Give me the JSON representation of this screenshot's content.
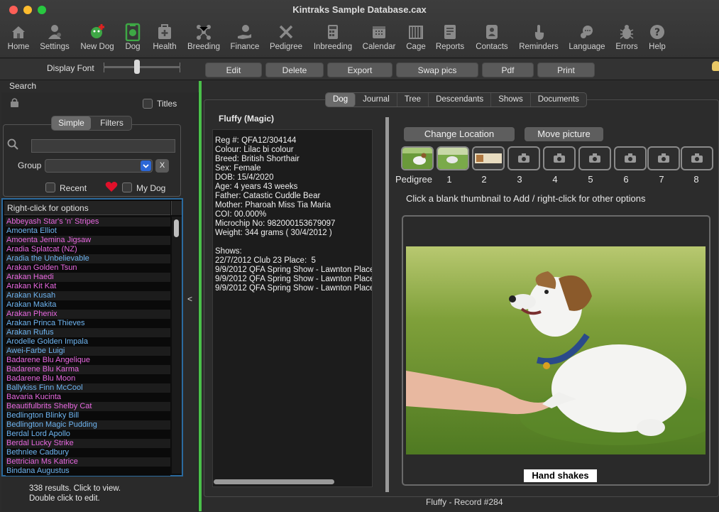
{
  "window": {
    "title": "Kintraks Sample Database.cax"
  },
  "toolbar": {
    "items": [
      {
        "label": "Home",
        "icon": "home-icon"
      },
      {
        "label": "Settings",
        "icon": "settings-person-icon"
      },
      {
        "label": "New Dog",
        "icon": "new-dog-icon"
      },
      {
        "label": "Dog",
        "icon": "dog-clipboard-icon"
      },
      {
        "label": "Health",
        "icon": "health-kit-icon"
      },
      {
        "label": "Breeding",
        "icon": "breeding-tree-icon"
      },
      {
        "label": "Finance",
        "icon": "finance-hand-icon"
      },
      {
        "label": "Pedigree",
        "icon": "pedigree-tools-icon"
      },
      {
        "label": "Inbreeding",
        "icon": "calculator-icon"
      },
      {
        "label": "Calendar",
        "icon": "calendar-icon"
      },
      {
        "label": "Cage",
        "icon": "cage-icon"
      },
      {
        "label": "Reports",
        "icon": "reports-icon"
      },
      {
        "label": "Contacts",
        "icon": "contacts-icon"
      },
      {
        "label": "Reminders",
        "icon": "reminders-hand-icon"
      },
      {
        "label": "Language",
        "icon": "language-icon"
      },
      {
        "label": "Errors",
        "icon": "bug-icon"
      },
      {
        "label": "Help",
        "icon": "help-icon"
      }
    ]
  },
  "buttonbar": {
    "display_font": "Display Font",
    "buttons": [
      "Edit",
      "Delete",
      "Export",
      "Swap pics",
      "Pdf",
      "Print"
    ]
  },
  "search": {
    "label": "Search",
    "titles_label": "Titles",
    "seg_simple": "Simple",
    "seg_filters": "Filters",
    "group_label": "Group",
    "group_clear": "X",
    "recent_label": "Recent",
    "mydog_label": "My Dog"
  },
  "list": {
    "header": "Right-click for options",
    "rows": [
      {
        "name": "Abbeyash Star's 'n' Stripes",
        "color": "#e868e0"
      },
      {
        "name": "Amoenta Elliot",
        "color": "#6eb4f0"
      },
      {
        "name": "Amoenta Jemina Jigsaw",
        "color": "#e868e0"
      },
      {
        "name": "Aradia Splatcat (NZ)",
        "color": "#e868e0"
      },
      {
        "name": "Aradia the Unbelievable",
        "color": "#6eb4f0"
      },
      {
        "name": "Arakan Golden Tsun",
        "color": "#e868e0"
      },
      {
        "name": "Arakan Haedi",
        "color": "#e868e0"
      },
      {
        "name": "Arakan Kit Kat",
        "color": "#e868e0"
      },
      {
        "name": "Arakan Kusah",
        "color": "#6eb4f0"
      },
      {
        "name": "Arakan Makita",
        "color": "#6eb4f0"
      },
      {
        "name": "Arakan Phenix",
        "color": "#e868e0"
      },
      {
        "name": "Arakan Princa Thieves",
        "color": "#6eb4f0"
      },
      {
        "name": "Arakan Rufus",
        "color": "#6eb4f0"
      },
      {
        "name": "Arodelle Golden Impala",
        "color": "#6eb4f0"
      },
      {
        "name": "Awei-Farbe Luigi",
        "color": "#6eb4f0"
      },
      {
        "name": "Badarene Blu Angelique",
        "color": "#e868e0"
      },
      {
        "name": "Badarene Blu Karma",
        "color": "#e868e0"
      },
      {
        "name": "Badarene Blu Moon",
        "color": "#e868e0"
      },
      {
        "name": "Ballykiss Finn McCool",
        "color": "#6eb4f0"
      },
      {
        "name": "Bavaria Kucinta",
        "color": "#e868e0"
      },
      {
        "name": "Beautifulbrits Shelby Cat",
        "color": "#e868e0"
      },
      {
        "name": "Bedlington Blinky Bill",
        "color": "#6eb4f0"
      },
      {
        "name": "Bedlington Magic Pudding",
        "color": "#6eb4f0"
      },
      {
        "name": "Berdal Lord Apollo",
        "color": "#6eb4f0"
      },
      {
        "name": "Berdal Lucky Strike",
        "color": "#e868e0"
      },
      {
        "name": "Bethnlee Cadbury",
        "color": "#6eb4f0"
      },
      {
        "name": "Bettrician Ms Katrice",
        "color": "#e868e0"
      },
      {
        "name": "Bindana Augustus",
        "color": "#6eb4f0"
      }
    ],
    "results_line1": "338 results. Click to view.",
    "results_line2": "Double click to edit.",
    "collapse": "<"
  },
  "tabs": [
    "Dog",
    "Journal",
    "Tree",
    "Descendants",
    "Shows",
    "Documents"
  ],
  "dog": {
    "heading": "Fluffy  (Magic)",
    "info": "Reg #: QFA12/304144\nColour: Lilac bi colour\nBreed: British Shorthair\nSex: Female\nDOB: 15/4/2020\nAge: 4 years 43 weeks\nFather: Catastic Cuddle Bear\nMother: Pharoah Miss Tia Maria\nCOI: 00.000%\nMicrochip No: 982000153679097\nWeight: 344 grams ( 30/4/2012 )\n\nShows:\n22/7/2012 Club 23 Place:  5\n9/9/2012 QFA Spring Show - Lawnton Place\n9/9/2012 QFA Spring Show - Lawnton Place\n9/9/2012 QFA Spring Show - Lawnton Place"
  },
  "pictures": {
    "change_location": "Change Location",
    "move_picture": "Move picture",
    "thumb_labels": [
      "Pedigree",
      "1",
      "2",
      "3",
      "4",
      "5",
      "6",
      "7",
      "8"
    ],
    "hint": "Click a blank thumbnail to Add / right-click for other options",
    "caption": "Hand shakes"
  },
  "status": {
    "record": "Fluffy - Record #284"
  }
}
